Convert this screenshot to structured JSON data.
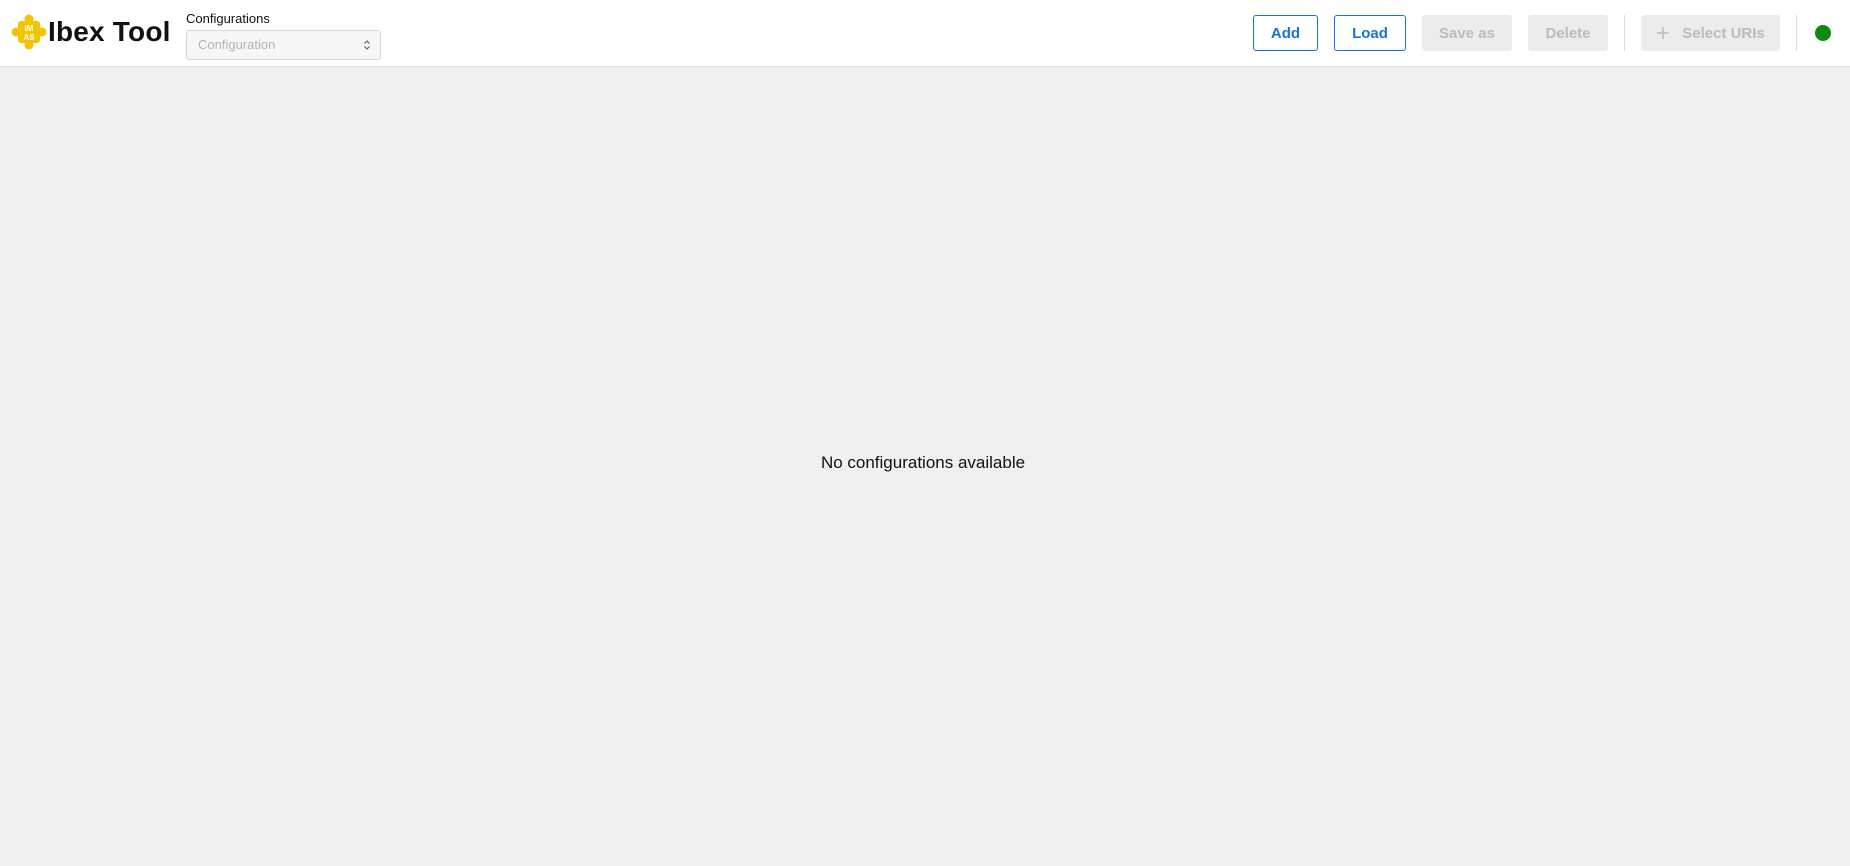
{
  "header": {
    "title": "Ibex Tool",
    "logo_icon": "puzzle-piece-icon",
    "logo_text_top": "IM",
    "logo_text_bottom": "AS"
  },
  "config": {
    "label": "Configurations",
    "placeholder": "Configuration"
  },
  "toolbar": {
    "add_label": "Add",
    "load_label": "Load",
    "save_as_label": "Save as",
    "delete_label": "Delete",
    "select_uris_label": "Select URIs"
  },
  "status": {
    "color": "#0e8a12",
    "icon": "status-dot-icon"
  },
  "main": {
    "empty_message": "No configurations available"
  },
  "colors": {
    "accent": "#1a73d6",
    "logo": "#f5c400",
    "background": "#f0f0f0"
  }
}
